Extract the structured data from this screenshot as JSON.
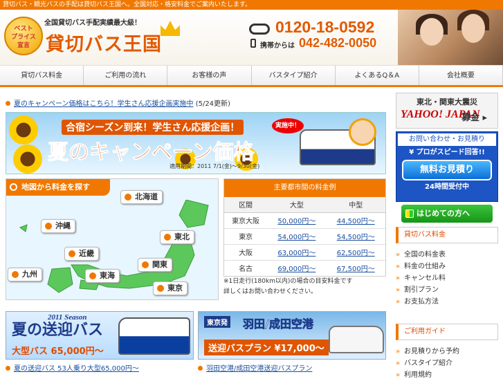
{
  "top_bar": {
    "text": "貸切バス・観光バスの手配は貸切バス王国へ。全国対応・格安料金でご案内いたします。"
  },
  "header": {
    "badge": [
      "ベスト",
      "プライス",
      "宣言"
    ],
    "tagline": "全国貸切バス手配実績最大級！",
    "logo_title": "貸切バス王国",
    "tel_main": "0120-18-0592",
    "mobile_label": "携帯からは",
    "tel_sub": "042-482-0050"
  },
  "nav": {
    "items": [
      "貸切バス料金",
      "ご利用の流れ",
      "お客様の声",
      "バスタイプ紹介",
      "よくあるQ＆A",
      "会社概要"
    ]
  },
  "news": {
    "link": "夏のキャンペーン価格はこちら！学生さん応援企画実施中",
    "date": "(5/24更新)"
  },
  "campaign_banner": {
    "headline": "合宿シーズン到来！学生さん応援企画！",
    "title": "夏のキャンペーン価格",
    "badge": "実施中！",
    "period": "適用期間：2011 7/1(金)〜9/30(金)"
  },
  "map": {
    "header": "地図から料金を探す",
    "regions": [
      "北海道",
      "東北",
      "関東",
      "東京",
      "東海",
      "近畿",
      "九州",
      "沖縄"
    ]
  },
  "price_table": {
    "caption": "主要都市間の料金例",
    "headers": [
      "区間",
      "大型",
      "中型"
    ],
    "rows": [
      {
        "route": "東京大阪",
        "large": "50,000円〜",
        "medium": "44,500円〜"
      },
      {
        "route": "東京",
        "large": "54,000円〜",
        "medium": "54,500円〜"
      },
      {
        "route": "大阪",
        "large": "63,000円〜",
        "medium": "62,500円〜"
      },
      {
        "route": "名古",
        "large": "69,000円〜",
        "medium": "67,500円〜"
      }
    ],
    "note1": "※1日走行(180km以内)の場合の目安料金です",
    "note2": "詳しくはお問い合わせください。"
  },
  "banner_left": {
    "season": "2011 Season",
    "title": "夏の送迎バス",
    "price": "大型バス 65,000円〜"
  },
  "banner_right": {
    "tag": "東京発",
    "title": "羽田/成田空港",
    "plan": "送迎バスプラン ¥17,000〜"
  },
  "captions": {
    "left": "夏の送迎バス 53人乗り大型65,000円〜",
    "right": "羽田空港/成田空港送迎バスプラン"
  },
  "sidebar": {
    "disaster": {
      "line1": "東北・関東大震災",
      "yahoo": "YAHOO! JAPAN",
      "donation": "募金 ▸"
    },
    "contact": {
      "head": "お問い合わせ・お見積り",
      "sub": "¥ プロがスピード回答!!",
      "button": "無料お見積り",
      "foot": "24時間受付中"
    },
    "first_button": "はじめての方へ",
    "section1": {
      "title": "貸切バス料金",
      "items": [
        "全国の料金表",
        "料金の仕組み",
        "キャンセル料",
        "割引プラン",
        "お支払方法"
      ]
    },
    "section2": {
      "title": "ご利用ガイド",
      "items": [
        "お見積りから予約",
        "バスタイプ紹介",
        "利用規約"
      ]
    }
  }
}
